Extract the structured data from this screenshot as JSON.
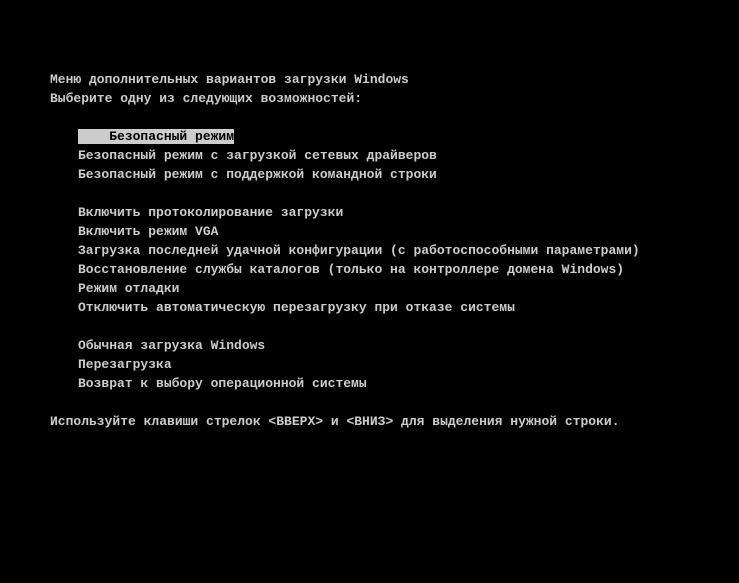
{
  "title": "Меню дополнительных вариантов загрузки Windows",
  "subtitle": "Выберите одну из следующих возможностей:",
  "menu": {
    "group1": [
      "Безопасный режим",
      "Безопасный режим с загрузкой сетевых драйверов",
      "Безопасный режим с поддержкой командной строки"
    ],
    "group2": [
      "Включить протоколирование загрузки",
      "Включить режим VGA",
      "Загрузка последней удачной конфигурации (с работоспособными параметрами)",
      "Восстановление службы каталогов (только на контроллере домена Windows)",
      "Режим отладки",
      "Отключить автоматическую перезагрузку при отказе системы"
    ],
    "group3": [
      "Обычная загрузка Windows",
      "Перезагрузка",
      "Возврат к выбору операционной системы"
    ],
    "selected_index": 0
  },
  "hint": "Используйте клавиши стрелок <ВВЕРХ> и <ВНИЗ> для выделения нужной строки."
}
